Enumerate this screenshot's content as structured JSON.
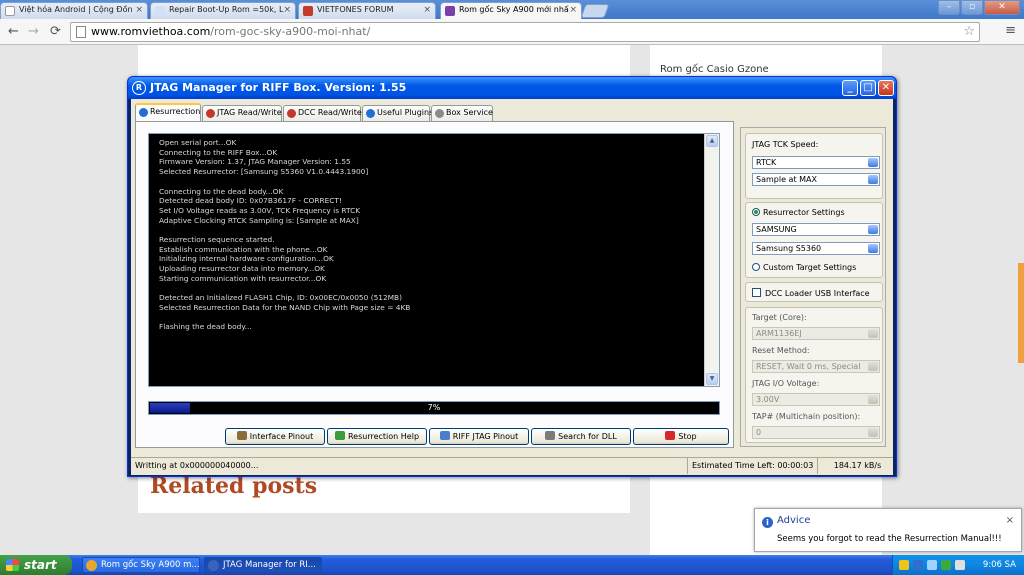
{
  "browser": {
    "tabs": [
      {
        "label": "Việt hóa Android | Cộng Đồn",
        "color": "#ffffff"
      },
      {
        "label": "Repair Boot-Up Rom =50k, L",
        "color": "#cfe0f7"
      },
      {
        "label": "VIETFONES FORUM",
        "color": "#c43a2a"
      },
      {
        "label": "Rom gốc Sky A900 mới nhấ",
        "color": "#7b3fa8"
      }
    ],
    "url_host": "www.romviethoa.com",
    "url_path": "/rom-goc-sky-a900-moi-nhat/",
    "win_minimize": "–",
    "win_maximize": "▫",
    "win_close": "✕",
    "tab_close": "×",
    "back": "←",
    "forward": "→",
    "reload": "⟳",
    "star": "☆",
    "wrench": "≡"
  },
  "webpage": {
    "sidebar_link": "Rom gốc Casio Gzone",
    "related_title": "Related posts"
  },
  "jtag": {
    "title": "JTAG Manager for RIFF Box. Version: 1.55",
    "title_icon": "R",
    "btn_min": "_",
    "btn_max": "□",
    "btn_close": "✕",
    "tabs": [
      {
        "label": "Resurrection",
        "color": "#1f6fd6"
      },
      {
        "label": "JTAG Read/Write",
        "color": "#c0392b"
      },
      {
        "label": "DCC Read/Write",
        "color": "#c0392b"
      },
      {
        "label": "Useful Plugins",
        "color": "#1f6fd6"
      },
      {
        "label": "Box Service",
        "color": "#8a8a8a"
      }
    ],
    "console_text": "Open serial port...OK\nConnecting to the RIFF Box...OK\nFirmware Version: 1.37, JTAG Manager Version: 1.55\nSelected Resurrector: [Samsung S5360 V1.0.4443.1900]\n\nConnecting to the dead body...OK\nDetected dead body ID: 0x07B3617F - CORRECT!\nSet I/O Voltage reads as 3.00V, TCK Frequency is RTCK\nAdaptive Clocking RTCK Sampling is: [Sample at MAX]\n\nResurrection sequence started.\nEstablish communication with the phone...OK\nInitializing internal hardware configuration...OK\nUploading resurrector data into memory...OK\nStarting communication with resurrector...OK\n\nDetected an Initialized FLASH1 Chip, ID: 0x00EC/0x0050 (512MB)\nSelected Resurrection Data for the NAND Chip with Page size = 4KB\n\nFlashing the dead body...",
    "progress_fraction": 0.07,
    "progress_label": "7%",
    "buttons": [
      {
        "label": "Interface Pinout",
        "color": "#8b6d3a"
      },
      {
        "label": "Resurrection Help",
        "color": "#3a9b3a"
      },
      {
        "label": "RIFF JTAG Pinout",
        "color": "#4a7fcf"
      },
      {
        "label": "Search for DLL",
        "color": "#7a7a7a"
      },
      {
        "label": "Stop",
        "color": "#d62a2a"
      }
    ],
    "right": {
      "tck_label": "JTAG TCK Speed:",
      "tck_value": "RTCK",
      "sample_value": "Sample at MAX",
      "resurrector_settings": "Resurrector Settings",
      "manufacturer": "SAMSUNG",
      "model": "Samsung S5360",
      "custom_target": "Custom Target Settings",
      "dcc_loader": "DCC Loader USB Interface",
      "target_core_label": "Target (Core):",
      "target_core_value": "ARM1136EJ",
      "reset_label": "Reset Method:",
      "reset_value": "RESET, Wait 0 ms, Special",
      "voltage_label": "JTAG I/O Voltage:",
      "voltage_value": "3.00V",
      "tap_label": "TAP# (Multichain position):",
      "tap_value": "0"
    },
    "status": {
      "left": "Writting at 0x000000040000...",
      "time_left": "Estimated Time Left: 00:00:03",
      "speed": "184.17 kB/s"
    }
  },
  "advice": {
    "icon": "i",
    "title": "Advice",
    "message": "Seems you forgot to read the Resurrection Manual!!!",
    "close": "×"
  },
  "taskbar": {
    "start": "start",
    "tasks": [
      {
        "label": "Rom gốc Sky A900 m...",
        "color": "#e7a72e"
      },
      {
        "label": "JTAG Manager for RI...",
        "color": "#3a62b8"
      }
    ],
    "clock": "9:06 SA",
    "tray_colors": [
      "#f0c419",
      "#2f6fd0",
      "#9fd4ff",
      "#3ba93b",
      "#e0e0e0"
    ]
  }
}
